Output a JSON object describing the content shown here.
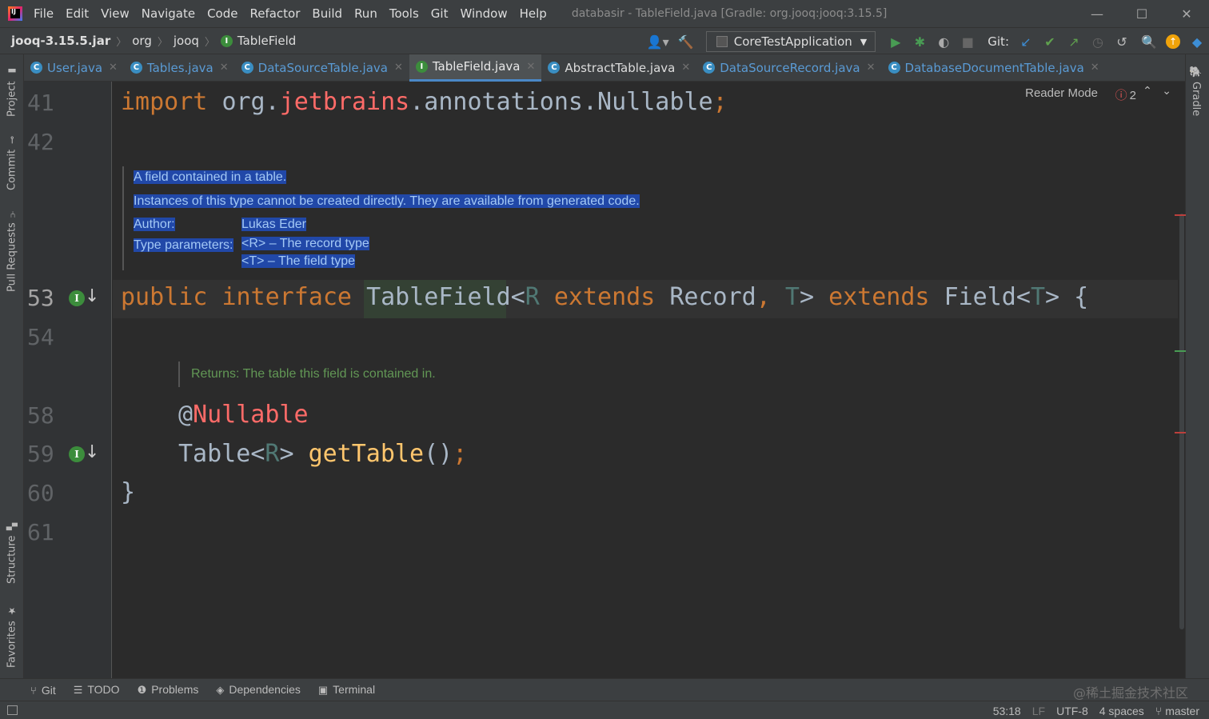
{
  "window": {
    "title": "databasir - TableField.java [Gradle: org.jooq:jooq:3.15.5]",
    "menu": [
      "File",
      "Edit",
      "View",
      "Navigate",
      "Code",
      "Refactor",
      "Build",
      "Run",
      "Tools",
      "Git",
      "Window",
      "Help"
    ],
    "controls": {
      "minimize": "—",
      "maximize": "☐",
      "close": "✕"
    }
  },
  "breadcrumb": {
    "items": [
      "jooq-3.15.5.jar",
      "org",
      "jooq"
    ],
    "current": "TableField"
  },
  "toolbar": {
    "run_config": "CoreTestApplication",
    "git_label": "Git:"
  },
  "tabs": [
    {
      "label": "User.java",
      "badge": "C",
      "active": false
    },
    {
      "label": "Tables.java",
      "badge": "C",
      "active": false
    },
    {
      "label": "DataSourceTable.java",
      "badge": "C",
      "active": false
    },
    {
      "label": "TableField.java",
      "badge": "I",
      "active": true
    },
    {
      "label": "AbstractTable.java",
      "badge": "C",
      "active": false
    },
    {
      "label": "DataSourceRecord.java",
      "badge": "C",
      "active": false
    },
    {
      "label": "DatabaseDocumentTable.java",
      "badge": "C",
      "active": false
    }
  ],
  "left_tools": [
    "Project",
    "Commit",
    "Pull Requests",
    "Structure",
    "Favorites"
  ],
  "right_tools": [
    "Gradle"
  ],
  "editor": {
    "reader_mode": "Reader Mode",
    "error_count": "2",
    "line_numbers": [
      "41",
      "42",
      "53",
      "54",
      "58",
      "59",
      "60",
      "61"
    ],
    "code": {
      "l41": {
        "kw": "import",
        "pre": "org.",
        "pkg": "jetbrains",
        "post": ".annotations.Nullable",
        "semi": ";"
      },
      "l53": {
        "public": "public",
        "interface": "interface",
        "name": "TableField",
        "lt": "<",
        "r": "R",
        "extends1": "extends",
        "record": "Record",
        "comma": ",",
        "t": "T",
        "gt": ">",
        "extends2": "extends",
        "field": "Field",
        "lt2": "<",
        "t2": "T",
        "gt2": ">",
        "brace": "{"
      },
      "l58": {
        "at": "@",
        "name": "Nullable"
      },
      "l59": {
        "type": "Table",
        "lt": "<",
        "r": "R",
        "gt": ">",
        "method": "getTable",
        "parens": "()",
        "semi": ";"
      },
      "l60": {
        "brace": "}"
      }
    },
    "doc1": {
      "summary": "A field contained in a table.",
      "description": "Instances of this type cannot be created directly. They are available from generated code.",
      "author_key": "Author:",
      "author_val": "Lukas Eder",
      "tparams_key": "Type parameters:",
      "tparam_r": "<R> – The record type",
      "tparam_t": "<T> – The field type"
    },
    "doc2": {
      "returns": "Returns: The table this field is contained in."
    }
  },
  "bottom_tools": [
    {
      "icon": "git",
      "label": "Git"
    },
    {
      "icon": "todo",
      "label": "TODO"
    },
    {
      "icon": "problems",
      "label": "Problems"
    },
    {
      "icon": "dependencies",
      "label": "Dependencies"
    },
    {
      "icon": "terminal",
      "label": "Terminal"
    }
  ],
  "watermark": "@稀土掘金技术社区",
  "status": {
    "position": "53:18",
    "line_sep": "LF",
    "encoding": "UTF-8",
    "indent": "4 spaces",
    "branch": "master"
  },
  "colors": {
    "keyword": "#cc7832",
    "type_param": "#507874",
    "method": "#ffc66d",
    "package_highlight": "#ff6b68",
    "doc_selection": "#2148a8",
    "doc_text": "#629755"
  }
}
